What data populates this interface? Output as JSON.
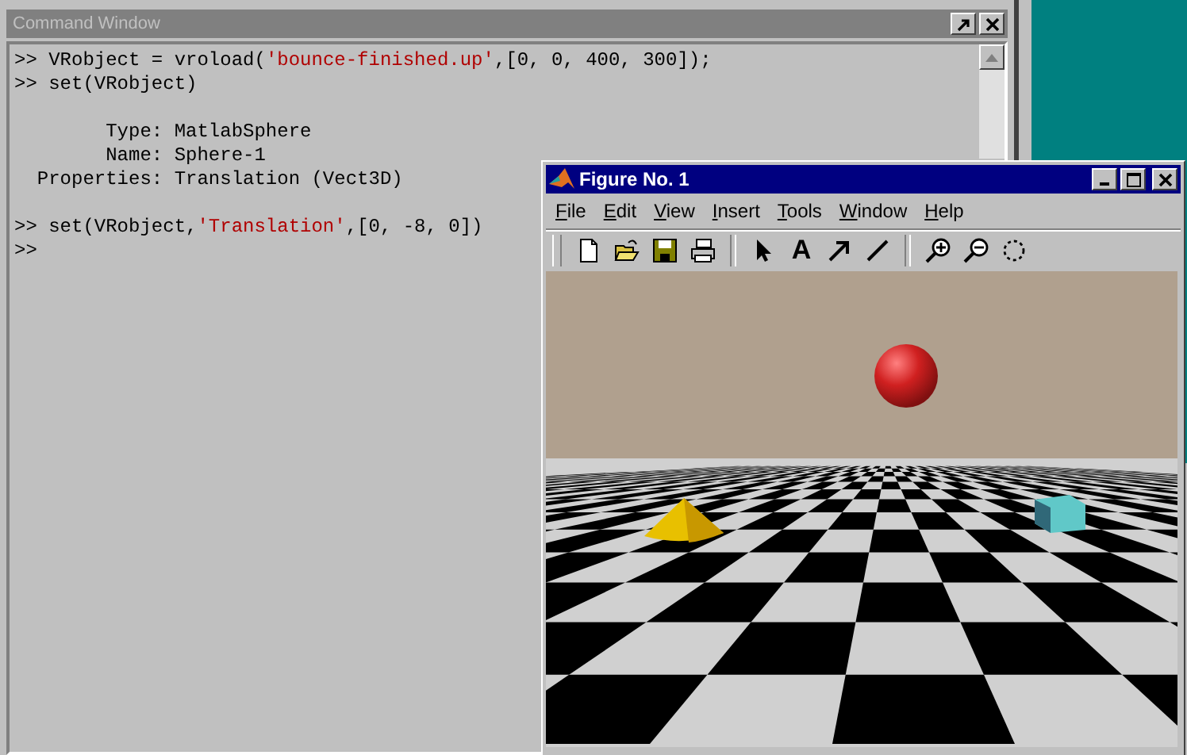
{
  "command_window": {
    "title": "Command Window",
    "blocks": [
      [
        [
          {
            "kind": "code",
            "text": ">> VRobject = vroload("
          },
          {
            "kind": "string",
            "text": "'bounce-finished.up'"
          },
          {
            "kind": "code",
            "text": ",[0, 0, 400, 300]);"
          }
        ],
        [
          {
            "kind": "code",
            "text": ">> set(VRobject)"
          }
        ]
      ],
      [
        [
          {
            "kind": "code",
            "text": "        Type: MatlabSphere"
          }
        ],
        [
          {
            "kind": "code",
            "text": "        Name: Sphere-1"
          }
        ],
        [
          {
            "kind": "code",
            "text": "  Properties: Translation (Vect3D)"
          }
        ]
      ],
      [
        [
          {
            "kind": "code",
            "text": ">> set(VRobject,"
          },
          {
            "kind": "string",
            "text": "'Translation'"
          },
          {
            "kind": "code",
            "text": ",[0, -8, 0])"
          }
        ],
        [
          {
            "kind": "code",
            "text": ">>"
          }
        ]
      ]
    ]
  },
  "figure_window": {
    "title": "Figure No. 1",
    "menu": [
      "File",
      "Edit",
      "View",
      "Insert",
      "Tools",
      "Window",
      "Help"
    ],
    "toolbar": [
      {
        "kind": "new"
      },
      {
        "kind": "open"
      },
      {
        "kind": "save"
      },
      {
        "kind": "print"
      },
      {
        "kind": "sep"
      },
      {
        "kind": "pointer"
      },
      {
        "kind": "text",
        "glyph": "A"
      },
      {
        "kind": "arrow"
      },
      {
        "kind": "line"
      },
      {
        "kind": "sep"
      },
      {
        "kind": "zoom-in"
      },
      {
        "kind": "zoom-out"
      },
      {
        "kind": "rotate"
      }
    ]
  }
}
